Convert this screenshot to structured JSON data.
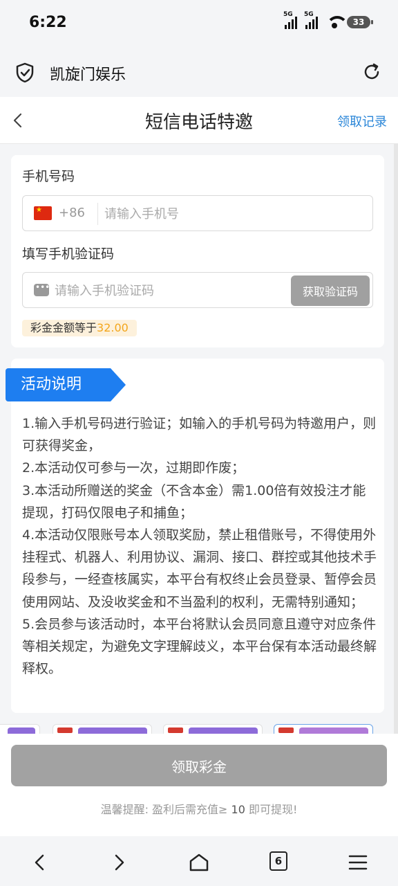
{
  "status_bar": {
    "time": "6:22",
    "signal_1_label": "5G",
    "signal_2_label": "5G",
    "battery": "33"
  },
  "browser": {
    "title": "凯旋门娱乐",
    "shield_icon": "shield-check-icon",
    "refresh_icon": "refresh-icon"
  },
  "header": {
    "title": "短信电话特邀",
    "records_link": "领取记录",
    "back_icon": "chevron-left-icon"
  },
  "form": {
    "phone_label": "手机号码",
    "country_code": "+86",
    "phone_placeholder": "请输入手机号",
    "phone_value": "",
    "code_label": "填写手机验证码",
    "code_placeholder": "请输入手机验证码",
    "code_value": "",
    "get_code_button": "获取验证码",
    "bonus_prefix": "彩金金额等于",
    "bonus_amount": "32.00"
  },
  "rules": {
    "title": "活动说明",
    "items": [
      "1.输入手机号码进行验证；如输入的手机号码为特邀用户，则可获得奖金，",
      "2.本活动仅可参与一次，过期即作废；",
      "3.本活动所赠送的奖金（不含本金）需1.00倍有效投注才能提现，打码仅限电子和捕鱼；",
      "4.本活动仅限账号本人领取奖励，禁止租借账号，不得使用外挂程式、机器人、利用协议、漏洞、接口、群控或其他技术手段参与，一经查核属实，本平台有权终止会员登录、暂停会员使用网站、及没收奖金和不当盈利的权利，无需特别通知；",
      "5.会员参与该活动时，本平台将默认会员同意且遵守对应条件等相关规定，为避免文字理解歧义，本平台保有本活动最终解释权。"
    ]
  },
  "action": {
    "claim_button": "领取彩金",
    "reminder_prefix": "温馨提醒: 盈利后需充值≥ ",
    "reminder_amount": "10",
    "reminder_suffix": " 即可提现!"
  },
  "bottom_nav": {
    "tab_count": "6"
  },
  "colors": {
    "accent_blue": "#1e7ef0",
    "link_blue": "#2a86d8",
    "bonus_gold": "#f3a61c",
    "disabled_gray": "#a2a2a2"
  }
}
